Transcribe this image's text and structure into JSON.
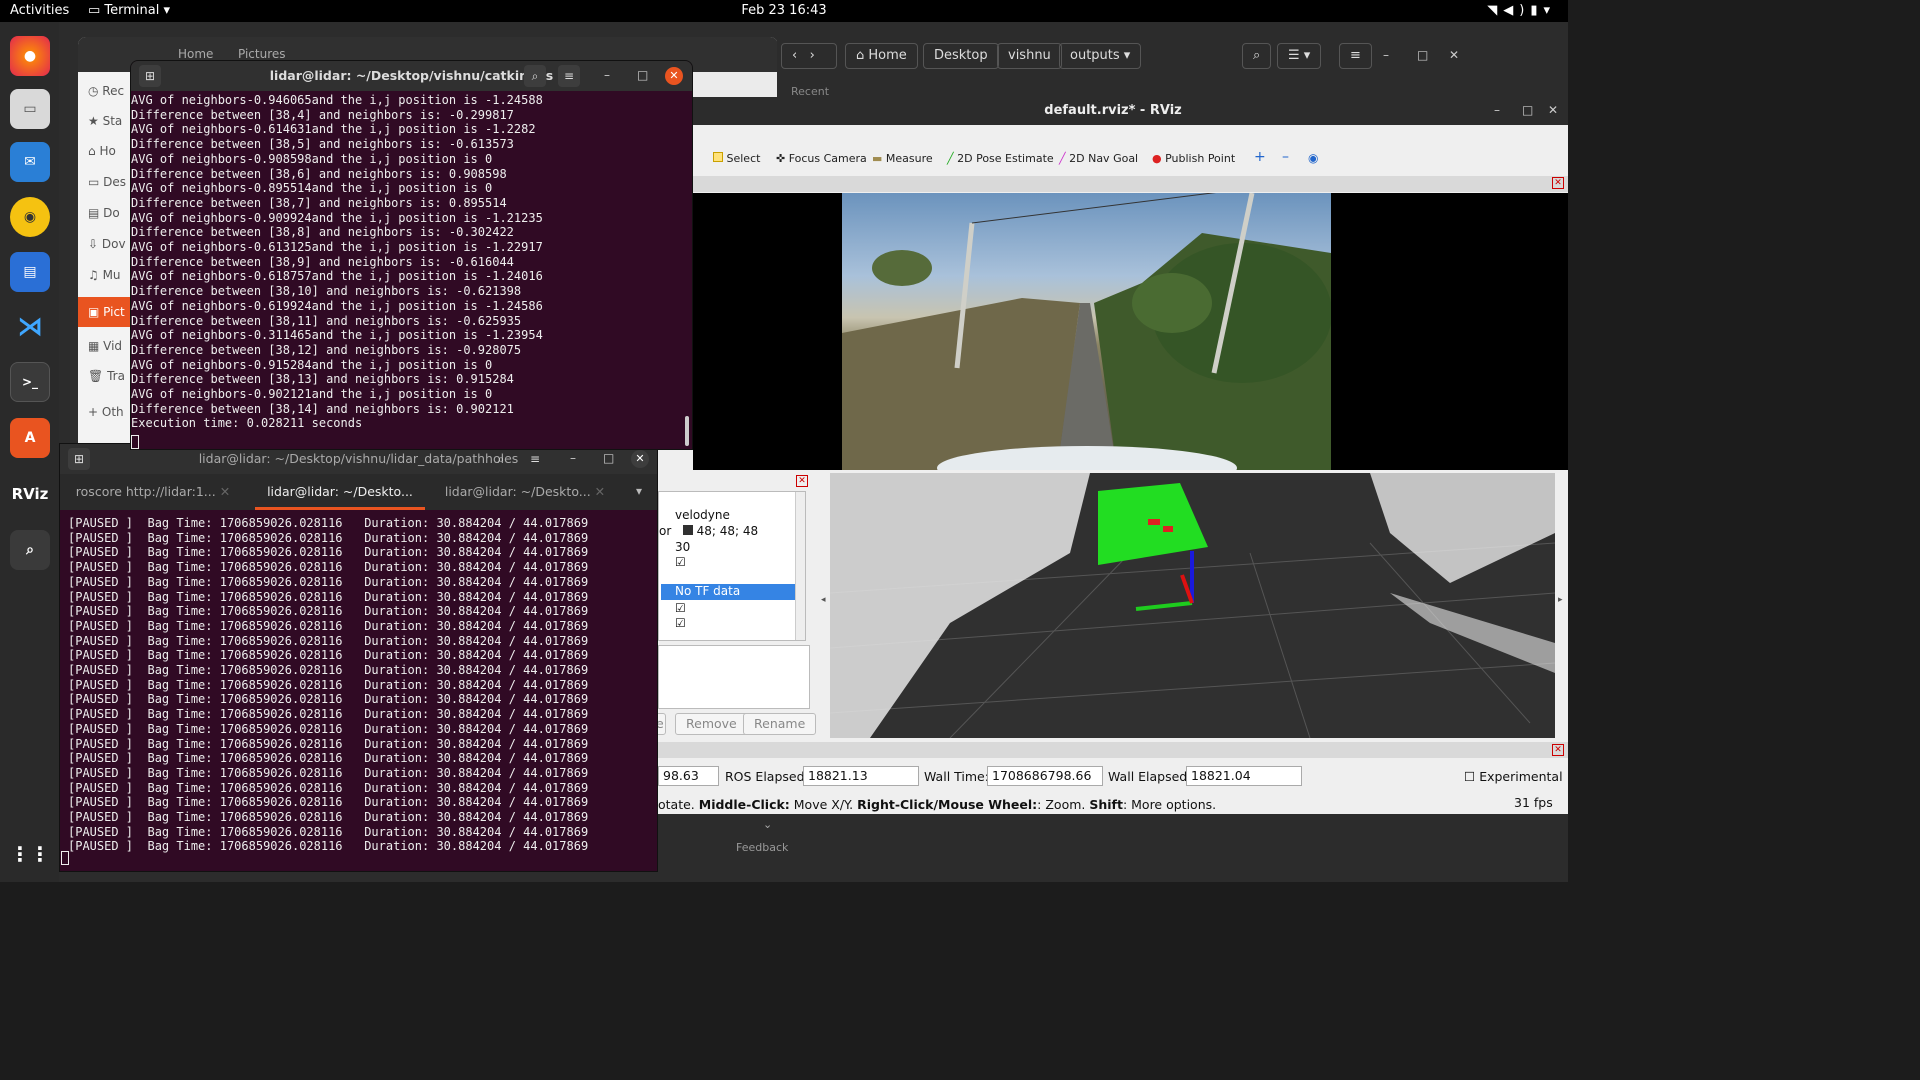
{
  "topbar": {
    "activities": "Activities",
    "app_name": "Terminal",
    "clock": "Feb 23  16:43"
  },
  "dock": {
    "items": [
      "firefox",
      "files",
      "thunderbird",
      "rhythmbox",
      "writer",
      "vscode",
      "terminal",
      "software",
      "rviz",
      "search"
    ],
    "rviz_label": "RViz"
  },
  "files_left": {
    "sidebar": [
      "Rec",
      "Sta",
      "Ho",
      "Des",
      "Do",
      "Dov",
      "Mu",
      "Pict",
      "Vid",
      "Tra",
      "Oth"
    ]
  },
  "files_left_header": {
    "home": "Home",
    "pictures": "Pictures"
  },
  "files_right": {
    "crumbs": [
      "Home",
      "Desktop",
      "vishnu",
      "outputs"
    ],
    "recent": "Recent"
  },
  "term1": {
    "title": "lidar@lidar: ~/Desktop/vishnu/catkin_ws",
    "lines": [
      "AVG of neighbors-0.946065and the i,j position is -1.24588",
      "Difference between [38,4] and neighbors is: -0.299817",
      "AVG of neighbors-0.614631and the i,j position is -1.2282",
      "Difference between [38,5] and neighbors is: -0.613573",
      "AVG of neighbors-0.908598and the i,j position is 0",
      "Difference between [38,6] and neighbors is: 0.908598",
      "AVG of neighbors-0.895514and the i,j position is 0",
      "Difference between [38,7] and neighbors is: 0.895514",
      "AVG of neighbors-0.909924and the i,j position is -1.21235",
      "Difference between [38,8] and neighbors is: -0.302422",
      "AVG of neighbors-0.613125and the i,j position is -1.22917",
      "Difference between [38,9] and neighbors is: -0.616044",
      "AVG of neighbors-0.618757and the i,j position is -1.24016",
      "Difference between [38,10] and neighbors is: -0.621398",
      "AVG of neighbors-0.619924and the i,j position is -1.24586",
      "Difference between [38,11] and neighbors is: -0.625935",
      "AVG of neighbors-0.311465and the i,j position is -1.23954",
      "Difference between [38,12] and neighbors is: -0.928075",
      "AVG of neighbors-0.915284and the i,j position is 0",
      "Difference between [38,13] and neighbors is: 0.915284",
      "AVG of neighbors-0.902121and the i,j position is 0",
      "Difference between [38,14] and neighbors is: 0.902121",
      "Execution time: 0.028211 seconds"
    ]
  },
  "term2": {
    "title": "lidar@lidar: ~/Desktop/vishnu/lidar_data/pathholes",
    "tabs": [
      "roscore http://lidar:1...",
      "lidar@lidar: ~/Deskto...",
      "lidar@lidar: ~/Deskto..."
    ],
    "line": "[PAUSED ]  Bag Time: 1706859026.028116   Duration: 30.884204 / 44.017869",
    "line_count": 23
  },
  "rviz": {
    "title": "default.rviz* - RViz",
    "tools": [
      "Select",
      "Focus Camera",
      "Measure",
      "2D Pose Estimate",
      "2D Nav Goal",
      "Publish Point"
    ],
    "tree": {
      "velodyne": "velodyne",
      "color_prefix": "or",
      "color": "48; 48; 48",
      "size": "30",
      "no_tf": "No TF data"
    },
    "buttons": {
      "remove": "Remove",
      "rename": "Rename",
      "partial": "e"
    },
    "time": {
      "ros_time_partial": "98.63",
      "ros_elapsed_label": "ROS Elapsed:",
      "ros_elapsed": "18821.13",
      "wall_time_label": "Wall Time:",
      "wall_time": "1708686798.66",
      "wall_elapsed_label": "Wall Elapsed:",
      "wall_elapsed": "18821.04",
      "experimental": "Experimental"
    },
    "hint_prefix": "otate. ",
    "hint_middle": "Middle-Click:",
    "hint_middle_t": " Move X/Y. ",
    "hint_right": "Right-Click/Mouse Wheel:",
    "hint_right_t": ": Zoom. ",
    "hint_shift": "Shift",
    "hint_shift_t": ": More options.",
    "fps": "31 fps",
    "feedback": "Feedback"
  }
}
